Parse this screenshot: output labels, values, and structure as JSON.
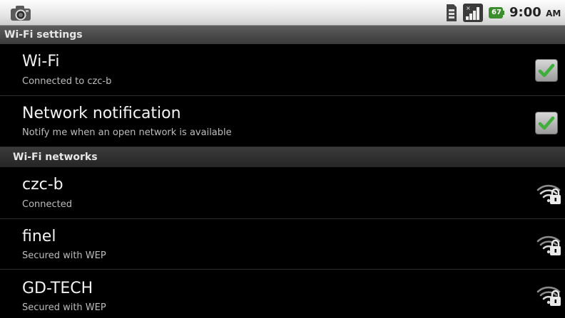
{
  "status_bar": {
    "time": "9:00",
    "ampm": "AM",
    "battery_level": "67",
    "icons": [
      "camera-icon",
      "sim-card-icon",
      "signal-icon",
      "battery-icon"
    ]
  },
  "wifi_settings": {
    "header": "Wi-Fi settings",
    "items": [
      {
        "title": "Wi-Fi",
        "summary": "Connected to czc-b",
        "checked": true
      },
      {
        "title": "Network notification",
        "summary": "Notify me when an open network is available",
        "checked": true
      }
    ]
  },
  "wifi_networks": {
    "header": "Wi-Fi networks",
    "items": [
      {
        "name": "czc-b",
        "status": "Connected",
        "icon": "wifi-locked-icon"
      },
      {
        "name": "finel",
        "status": "Secured with WEP",
        "icon": "wifi-locked-icon"
      },
      {
        "name": "GD-TECH",
        "status": "Secured with WEP",
        "icon": "wifi-locked-icon"
      }
    ]
  },
  "colors": {
    "check_green": "#3fae3a",
    "header_text": "#e6e6e6",
    "title_text": "#f2f2f2",
    "summary_text": "#bdbdbd"
  }
}
